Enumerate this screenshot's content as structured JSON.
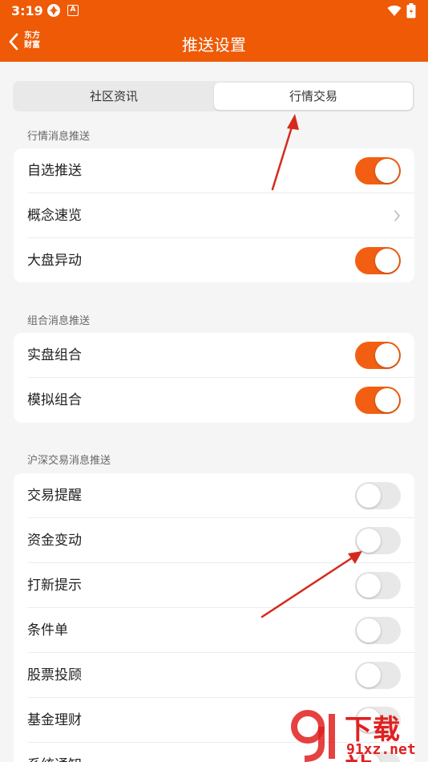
{
  "status_bar": {
    "time": "3:19",
    "icon2_text": "A",
    "icons": [
      "app-icon",
      "a-icon",
      "wifi-icon",
      "battery-icon"
    ]
  },
  "nav": {
    "title": "推送设置",
    "logo_text": "东方财富"
  },
  "segment": {
    "tabs": [
      {
        "label": "社区资讯",
        "selected": false
      },
      {
        "label": "行情交易",
        "selected": true
      }
    ]
  },
  "sections": [
    {
      "title": "行情消息推送",
      "rows": [
        {
          "label": "自选推送",
          "control": "toggle",
          "on": true
        },
        {
          "label": "概念速览",
          "control": "chevron"
        },
        {
          "label": "大盘异动",
          "control": "toggle",
          "on": true
        }
      ]
    },
    {
      "title": "组合消息推送",
      "rows": [
        {
          "label": "实盘组合",
          "control": "toggle",
          "on": true
        },
        {
          "label": "模拟组合",
          "control": "toggle",
          "on": true
        }
      ]
    },
    {
      "title": "沪深交易消息推送",
      "rows": [
        {
          "label": "交易提醒",
          "control": "toggle",
          "on": false
        },
        {
          "label": "资金变动",
          "control": "toggle",
          "on": false
        },
        {
          "label": "打新提示",
          "control": "toggle",
          "on": false
        },
        {
          "label": "条件单",
          "control": "toggle",
          "on": false
        },
        {
          "label": "股票投顾",
          "control": "toggle",
          "on": false
        },
        {
          "label": "基金理财",
          "control": "toggle",
          "on": false
        },
        {
          "label": "系统通知",
          "control": "toggle",
          "on": false
        }
      ]
    }
  ],
  "watermark": {
    "text_main": "下载站",
    "text_url": "91xz.net"
  },
  "colors": {
    "brand": "#ee5a06",
    "toggle_on": "#f35f12",
    "toggle_off": "#e8e8e8",
    "background": "#f5f5f5",
    "annotation_arrow": "#d42a1e"
  }
}
